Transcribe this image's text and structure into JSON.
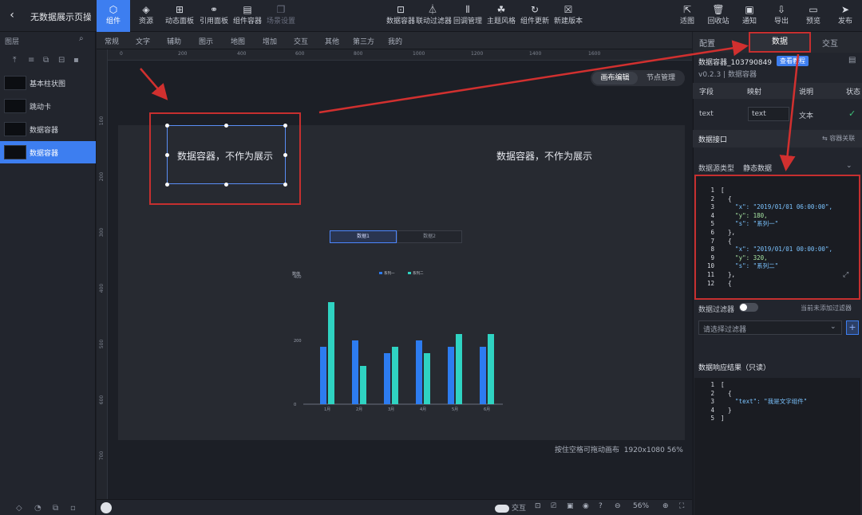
{
  "header": {
    "back_icon": "chevron-left-icon",
    "title": "无数据展示页操…",
    "tools": [
      {
        "label": "组件",
        "icon": "component-icon",
        "active": true
      },
      {
        "label": "资源",
        "icon": "layers-icon"
      },
      {
        "label": "动态面板",
        "icon": "panel-icon"
      },
      {
        "label": "引用面板",
        "icon": "link-icon"
      },
      {
        "label": "组件容器",
        "icon": "container-icon"
      },
      {
        "label": "场景设置",
        "icon": "scene-icon",
        "dim": true
      }
    ],
    "center_tools": [
      {
        "label": "数据容器",
        "icon": "data-container-icon"
      },
      {
        "label": "联动过滤器",
        "icon": "filter-icon"
      },
      {
        "label": "回调管理",
        "icon": "callback-icon"
      },
      {
        "label": "主题风格",
        "icon": "theme-icon"
      },
      {
        "label": "组件更新",
        "icon": "refresh-icon"
      },
      {
        "label": "新建版本",
        "icon": "new-version-icon"
      }
    ],
    "right_tools": [
      {
        "label": "适图",
        "icon": "fit-icon"
      },
      {
        "label": "回收站",
        "icon": "trash-icon"
      },
      {
        "label": "通知",
        "icon": "bell-icon"
      },
      {
        "label": "导出",
        "icon": "export-icon"
      },
      {
        "label": "预览",
        "icon": "preview-icon"
      },
      {
        "label": "发布",
        "icon": "publish-icon"
      }
    ]
  },
  "layers": {
    "title": "图层",
    "items": [
      {
        "label": "基本柱状图"
      },
      {
        "label": "跳动卡"
      },
      {
        "label": "数据容器"
      },
      {
        "label": "数据容器",
        "selected": true
      }
    ]
  },
  "categories": [
    "常规",
    "文字",
    "辅助",
    "图示",
    "地图",
    "增加",
    "交互",
    "其他",
    "第三方",
    "我的"
  ],
  "ruler": {
    "top": [
      "0",
      "200",
      "400",
      "600",
      "800",
      "1000",
      "1200",
      "1400",
      "1600"
    ],
    "left": [
      "100",
      "200",
      "300",
      "400",
      "500",
      "600",
      "700",
      "800",
      "900",
      "1000"
    ]
  },
  "canvas": {
    "mode_canvas": "画布编辑",
    "mode_node": "节点管理",
    "container_text": "数据容器，不作为展示",
    "container_text_2": "数据容器，不作为展示",
    "chart_tab_1": "数据1",
    "chart_tab_2": "数据2",
    "hint": "按住空格可拖动画布",
    "size": "1920x1080 56%"
  },
  "bottom": {
    "interact_label": "交互",
    "zoom": "56%"
  },
  "chart_data": {
    "type": "bar",
    "categories": [
      "1月",
      "2月",
      "3月",
      "4月",
      "5月",
      "6月"
    ],
    "series": [
      {
        "name": "系列一",
        "values": [
          180,
          200,
          160,
          200,
          180,
          180
        ],
        "color": "#2d7cf0"
      },
      {
        "name": "系列二",
        "values": [
          320,
          120,
          180,
          160,
          220,
          220
        ],
        "color": "#2fd3c2"
      }
    ],
    "ylabel": "数值",
    "yticks": [
      "400",
      "200",
      "0"
    ],
    "ylim": [
      0,
      400
    ]
  },
  "right": {
    "tab_style": "配置",
    "tab_data": "数据",
    "tab_interact": "交互",
    "component_id": "数据容器_103790849",
    "view_doc": "查看教程",
    "version": "v0.2.3 | 数据容器",
    "map_headers": [
      "字段",
      "映射",
      "说明",
      "状态"
    ],
    "map_row": {
      "field": "text",
      "mapping": "text",
      "desc": "文本",
      "status": "✓"
    },
    "api_title": "数据接口",
    "api_link": "⇆ 容器关联",
    "source_type_label": "数据源类型",
    "source_type": "静态数据",
    "code_lines": [
      {
        "n": "1",
        "t": "[",
        "fold": "▾"
      },
      {
        "n": "2",
        "t": "  {",
        "fold": "▾"
      },
      {
        "n": "3",
        "t": "    \"x\": \"2019/01/01 06:00:00\","
      },
      {
        "n": "4",
        "t": "    \"y\": 180,"
      },
      {
        "n": "5",
        "t": "    \"s\": \"系列一\""
      },
      {
        "n": "6",
        "t": "  },"
      },
      {
        "n": "7",
        "t": "  {",
        "fold": "▾"
      },
      {
        "n": "8",
        "t": "    \"x\": \"2019/01/01 00:00:00\","
      },
      {
        "n": "9",
        "t": "    \"y\": 320,"
      },
      {
        "n": "10",
        "t": "    \"s\": \"系列二\""
      },
      {
        "n": "11",
        "t": "  },"
      },
      {
        "n": "12",
        "t": "  {",
        "fold": "▾"
      }
    ],
    "filter_label": "数据过滤器",
    "filter_note": "当前未添加过滤器",
    "filter_placeholder": "请选择过滤器",
    "response_title": "数据响应结果（只读）",
    "response_lines": [
      {
        "n": "1",
        "t": "[",
        "fold": "▾"
      },
      {
        "n": "2",
        "t": "  {",
        "fold": "▾"
      },
      {
        "n": "3",
        "t": "    \"text\": \"我是文字组件\""
      },
      {
        "n": "4",
        "t": "  }"
      },
      {
        "n": "5",
        "t": "]"
      }
    ]
  },
  "colors": {
    "accent": "#3d7ef0",
    "annotation": "#c62f2f"
  }
}
